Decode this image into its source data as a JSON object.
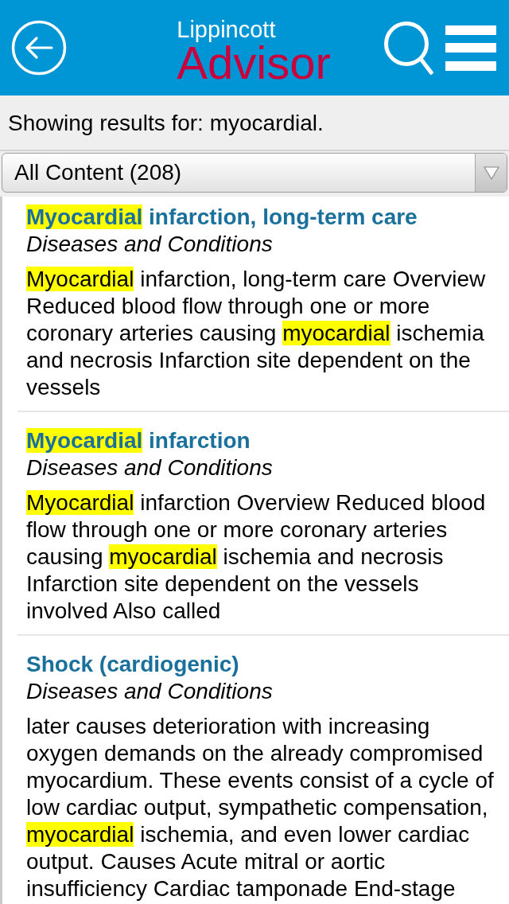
{
  "header": {
    "logo": {
      "line_1": "Lippincott",
      "line_2": "Advisor"
    }
  },
  "search_summary": "Showing results for: myocardial.",
  "filter_dropdown": {
    "value": "All Content (208)"
  },
  "results": [
    {
      "title": [
        {
          "text": "Myocardial",
          "highlighted": true
        },
        {
          "text": " infarction, long-term care",
          "highlighted": false
        }
      ],
      "category": "Diseases and Conditions",
      "snippet": [
        {
          "text": "Myocardial",
          "highlighted": true
        },
        {
          "text": " infarction, long-term care Overview Reduced blood flow through one or more coronary arteries causing ",
          "highlighted": false
        },
        {
          "text": "myocardial",
          "highlighted": true
        },
        {
          "text": " ischemia and necrosis Infarction site dependent on the vessels",
          "highlighted": false
        }
      ]
    },
    {
      "title": [
        {
          "text": "Myocardial",
          "highlighted": true
        },
        {
          "text": " infarction",
          "highlighted": false
        }
      ],
      "category": "Diseases and Conditions",
      "snippet": [
        {
          "text": "Myocardial",
          "highlighted": true
        },
        {
          "text": " infarction Overview Reduced blood flow through one or more coronary arteries causing ",
          "highlighted": false
        },
        {
          "text": "myocardial",
          "highlighted": true
        },
        {
          "text": " ischemia and necrosis Infarction site dependent on the vessels involved Also called",
          "highlighted": false
        }
      ]
    },
    {
      "title": [
        {
          "text": "Shock (cardiogenic)",
          "highlighted": false
        }
      ],
      "category": "Diseases and Conditions",
      "snippet": [
        {
          "text": "later causes deterioration with increasing oxygen demands on the already compromised myocardium. These events consist of a cycle of low cardiac output, sympathetic compensation, ",
          "highlighted": false
        },
        {
          "text": "myocardial",
          "highlighted": true
        },
        {
          "text": " ischemia, and even lower cardiac output. Causes Acute mitral or aortic insufficiency Cardiac tamponade End-stage",
          "highlighted": false
        }
      ]
    }
  ]
}
